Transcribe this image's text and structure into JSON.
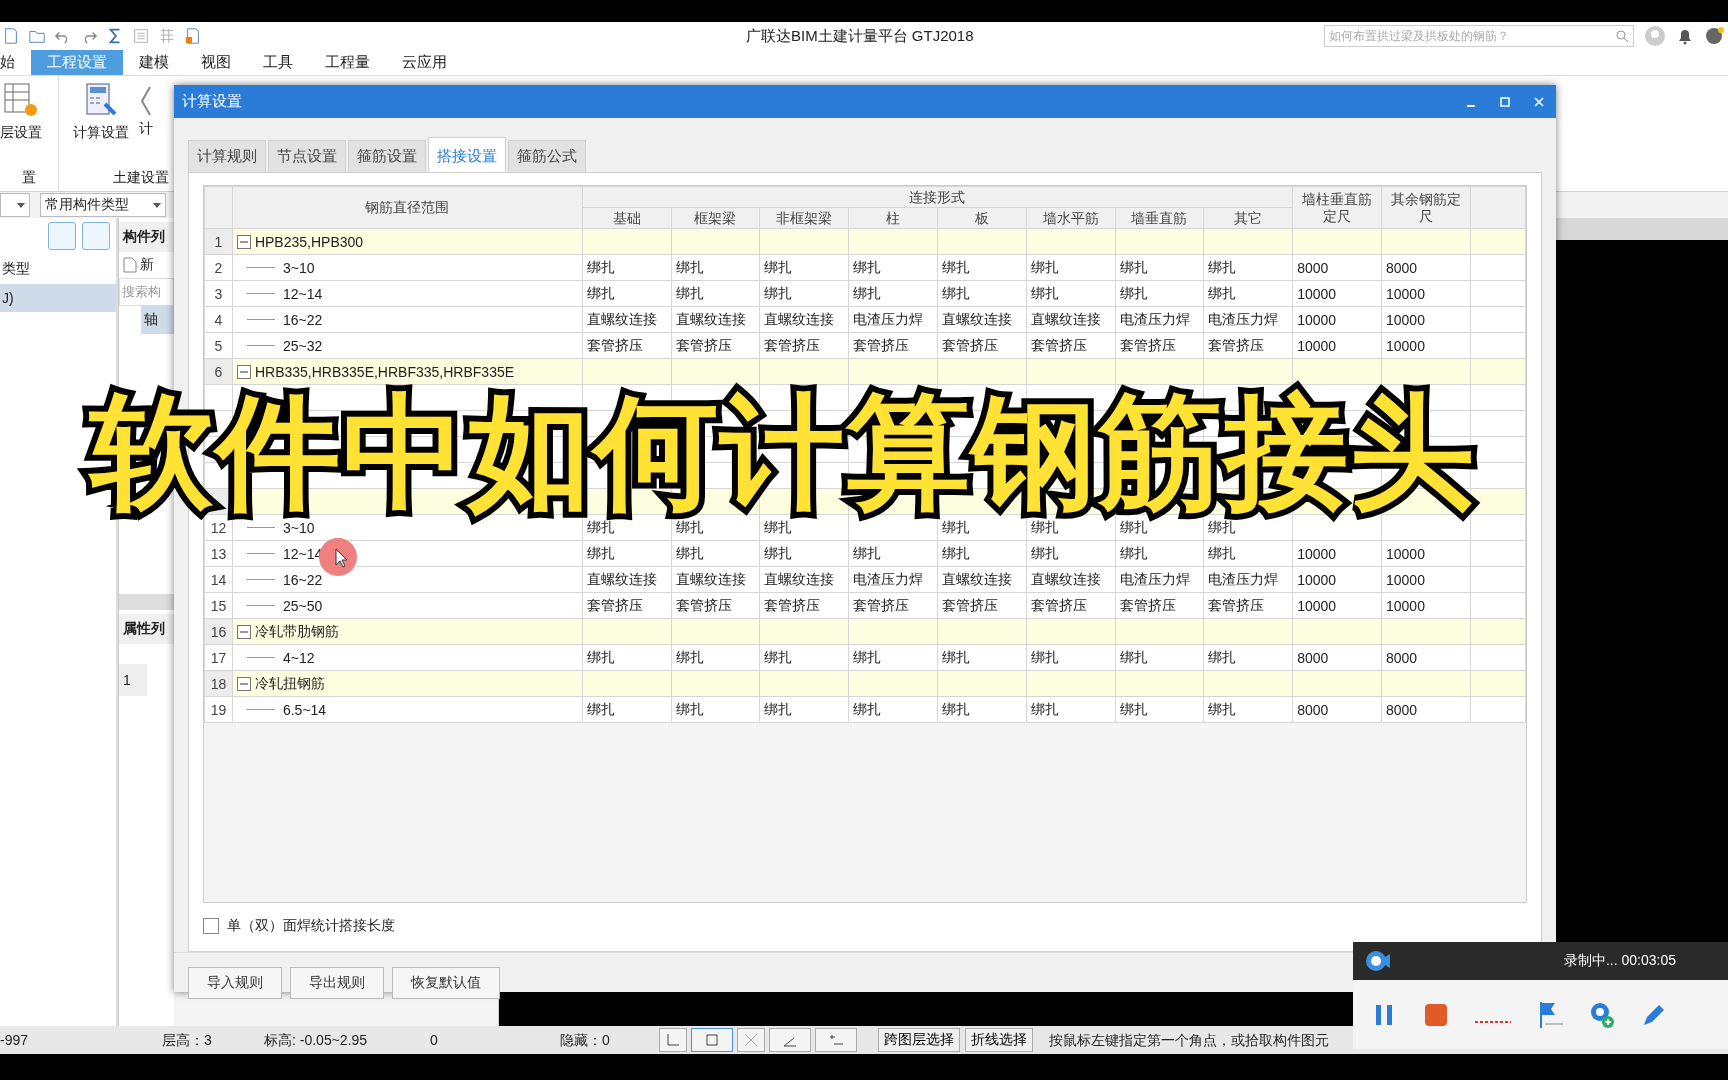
{
  "app": {
    "title": "广联达BIM土建计量平台 GTJ2018",
    "search": {
      "placeholder": "如何布置拱过梁及拱板处的钢筋？"
    }
  },
  "menu": [
    {
      "label": "始",
      "selected": false
    },
    {
      "label": "工程设置",
      "selected": true
    },
    {
      "label": "建模",
      "selected": false
    },
    {
      "label": "视图",
      "selected": false
    },
    {
      "label": "工具",
      "selected": false
    },
    {
      "label": "工程量",
      "selected": false
    },
    {
      "label": "云应用",
      "selected": false
    }
  ],
  "ribbon": {
    "buttons": [
      {
        "label": "层设置",
        "kind": "floor"
      },
      {
        "label": "计算设置",
        "kind": "calc"
      },
      {
        "label": "计",
        "kind": "partial"
      }
    ],
    "groups": [
      "置",
      "土建设置"
    ]
  },
  "left_pane": {
    "dropdown": "常用构件类型",
    "items": [
      {
        "label": "类型",
        "selected": false
      },
      {
        "label": "J)",
        "selected": true
      }
    ]
  },
  "component_pane": {
    "title": "构件列",
    "new_label": "新",
    "search_placeholder": "搜索构",
    "items": [
      {
        "label": "轴",
        "selected": true
      }
    ],
    "props_title": "属性列",
    "props_rows": [
      "1"
    ]
  },
  "dialog": {
    "title": "计算设置",
    "tabs": [
      {
        "label": "计算规则",
        "selected": false
      },
      {
        "label": "节点设置",
        "selected": false
      },
      {
        "label": "箍筋设置",
        "selected": false
      },
      {
        "label": "搭接设置",
        "selected": true
      },
      {
        "label": "箍筋公式",
        "selected": false
      }
    ],
    "table": {
      "range_header": "钢筋直径范围",
      "group_header": "连接形式",
      "columns": [
        "基础",
        "框架梁",
        "非框架梁",
        "柱",
        "板",
        "墙水平筋",
        "墙垂直筋",
        "其它"
      ],
      "extra_columns": [
        [
          "墙柱垂直筋",
          "定尺"
        ],
        [
          "其余钢筋定",
          "尺"
        ]
      ],
      "rows": [
        {
          "n": "1",
          "kind": "group",
          "label": "HPB235,HPB300",
          "expanded": true
        },
        {
          "n": "2",
          "kind": "item",
          "label": "3~10",
          "cells": [
            "绑扎",
            "绑扎",
            "绑扎",
            "绑扎",
            "绑扎",
            "绑扎",
            "绑扎",
            "绑扎",
            "8000",
            "8000"
          ]
        },
        {
          "n": "3",
          "kind": "item",
          "label": "12~14",
          "cells": [
            "绑扎",
            "绑扎",
            "绑扎",
            "绑扎",
            "绑扎",
            "绑扎",
            "绑扎",
            "绑扎",
            "10000",
            "10000"
          ]
        },
        {
          "n": "4",
          "kind": "item",
          "label": "16~22",
          "cells": [
            "直螺纹连接",
            "直螺纹连接",
            "直螺纹连接",
            "电渣压力焊",
            "直螺纹连接",
            "直螺纹连接",
            "电渣压力焊",
            "电渣压力焊",
            "10000",
            "10000"
          ]
        },
        {
          "n": "5",
          "kind": "item",
          "label": "25~32",
          "cells": [
            "套管挤压",
            "套管挤压",
            "套管挤压",
            "套管挤压",
            "套管挤压",
            "套管挤压",
            "套管挤压",
            "套管挤压",
            "10000",
            "10000"
          ]
        },
        {
          "n": "6",
          "kind": "group",
          "label": "HRB335,HRB335E,HRBF335,HRBF335E",
          "expanded": true
        },
        {
          "kind": "covered"
        },
        {
          "kind": "covered"
        },
        {
          "kind": "covered"
        },
        {
          "kind": "covered"
        },
        {
          "kind": "covered_group"
        },
        {
          "n": "12",
          "kind": "item",
          "label": "3~10",
          "cells": [
            "绑扎",
            "绑扎",
            "绑扎",
            null,
            "绑扎",
            "绑扎",
            "绑扎",
            "绑扎",
            null,
            null
          ]
        },
        {
          "n": "13",
          "kind": "item",
          "label": "12~14",
          "cells": [
            "绑扎",
            "绑扎",
            "绑扎",
            "绑扎",
            "绑扎",
            "绑扎",
            "绑扎",
            "绑扎",
            "10000",
            "10000"
          ]
        },
        {
          "n": "14",
          "kind": "item",
          "label": "16~22",
          "cells": [
            "直螺纹连接",
            "直螺纹连接",
            "直螺纹连接",
            "电渣压力焊",
            "直螺纹连接",
            "直螺纹连接",
            "电渣压力焊",
            "电渣压力焊",
            "10000",
            "10000"
          ]
        },
        {
          "n": "15",
          "kind": "item",
          "label": "25~50",
          "cells": [
            "套管挤压",
            "套管挤压",
            "套管挤压",
            "套管挤压",
            "套管挤压",
            "套管挤压",
            "套管挤压",
            "套管挤压",
            "10000",
            "10000"
          ]
        },
        {
          "n": "16",
          "kind": "group",
          "label": "冷轧带肋钢筋",
          "expanded": true
        },
        {
          "n": "17",
          "kind": "item",
          "label": "4~12",
          "cells": [
            "绑扎",
            "绑扎",
            "绑扎",
            "绑扎",
            "绑扎",
            "绑扎",
            "绑扎",
            "绑扎",
            "8000",
            "8000"
          ]
        },
        {
          "n": "18",
          "kind": "group",
          "label": "冷轧扭钢筋",
          "expanded": true
        },
        {
          "n": "19",
          "kind": "item",
          "label": "6.5~14",
          "cells": [
            "绑扎",
            "绑扎",
            "绑扎",
            "绑扎",
            "绑扎",
            "绑扎",
            "绑扎",
            "绑扎",
            "8000",
            "8000"
          ]
        }
      ]
    },
    "checkbox": {
      "label": "单（双）面焊统计搭接长度",
      "checked": false
    },
    "buttons": [
      "导入规则",
      "导出规则",
      "恢复默认值"
    ]
  },
  "status_bar": {
    "texts": [
      "-997",
      "层高：3",
      "标高: -0.05~2.95",
      "0",
      "隐藏：0"
    ],
    "buttons": [
      "跨图层选择",
      "折线选择"
    ],
    "hint": "按鼠标左键指定第一个角点，或拾取构件图元"
  },
  "recorder": {
    "status": "录制中... 00:03:05"
  },
  "caption": "软件中如何计算钢筋接头"
}
